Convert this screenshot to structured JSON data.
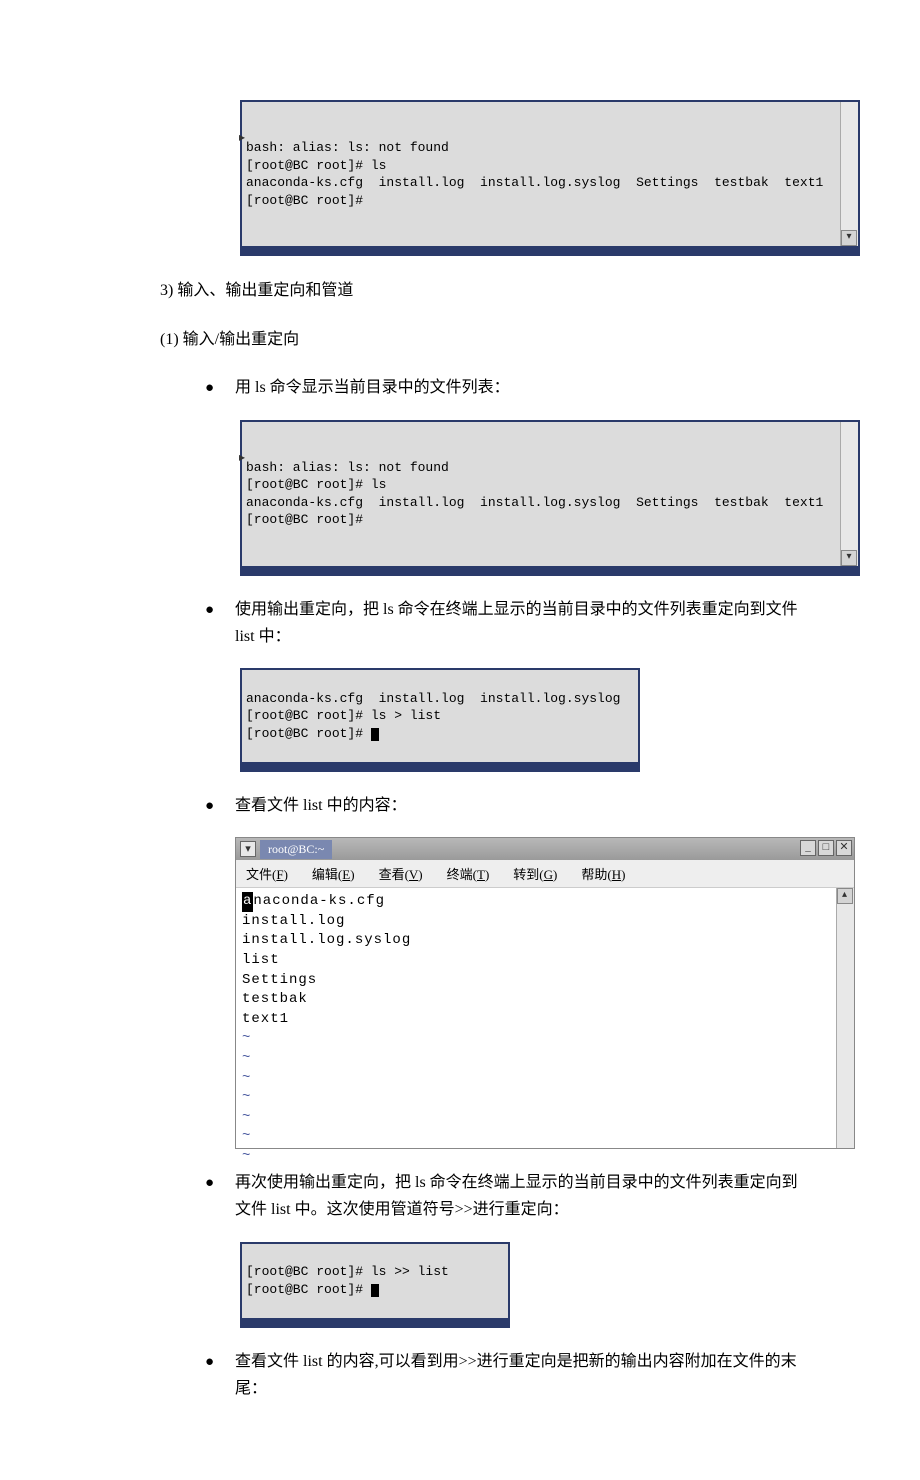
{
  "terminal1": {
    "line0": "bash: alias: ls: not found",
    "line1": "[root@BC root]# ls",
    "line2": "anaconda-ks.cfg  install.log  install.log.syslog  Settings  testbak  text1",
    "line3": "[root@BC root]#"
  },
  "heading3": "3)  输入、输出重定向和管道",
  "sub1": "(1)  输入/输出重定向",
  "bullet1": "用 ls 命令显示当前目录中的文件列表：",
  "terminal2": {
    "line0": "bash: alias: ls: not found",
    "line1": "[root@BC root]# ls",
    "line2": "anaconda-ks.cfg  install.log  install.log.syslog  Settings  testbak  text1",
    "line3": "[root@BC root]#"
  },
  "bullet2": "使用输出重定向，把 ls 命令在终端上显示的当前目录中的文件列表重定向到文件 list 中：",
  "terminal3": {
    "line1": "anaconda-ks.cfg  install.log  install.log.syslog",
    "line2": "[root@BC root]# ls > list",
    "line3": "[root@BC root]# "
  },
  "bullet3": "查看文件 list 中的内容：",
  "editor": {
    "title": "root@BC:~",
    "menus": {
      "file": "文件(F)",
      "edit": "编辑(E)",
      "view": "查看(V)",
      "terminal": "终端(T)",
      "go": "转到(G)",
      "help": "帮助(H)"
    },
    "lines": [
      "anaconda-ks.cfg",
      "install.log",
      "install.log.syslog",
      "list",
      "Settings",
      "testbak",
      "text1"
    ]
  },
  "bullet4": "再次使用输出重定向，把 ls 命令在终端上显示的当前目录中的文件列表重定向到文件 list 中。这次使用管道符号>>进行重定向：",
  "terminal4": {
    "line1": "[root@BC root]# ls >> list",
    "line2": "[root@BC root]# "
  },
  "bullet5": "查看文件 list 的内容,可以看到用>>进行重定向是把新的输出内容附加在文件的末尾："
}
